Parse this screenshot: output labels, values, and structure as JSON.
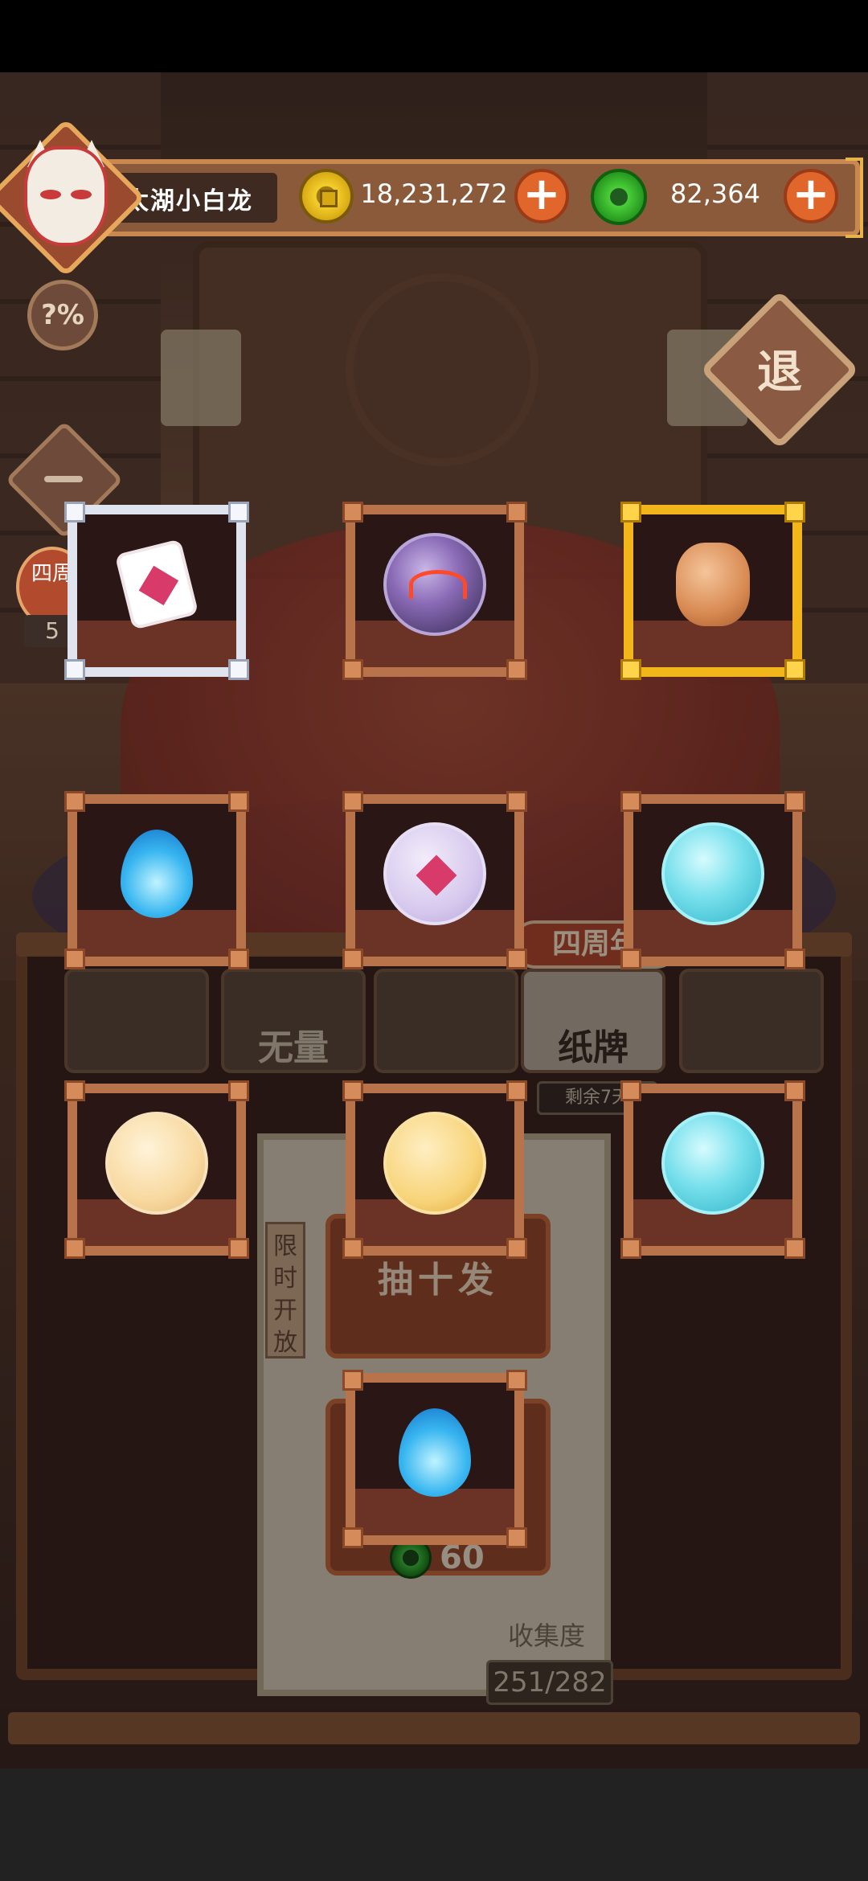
{
  "hud": {
    "player_name": "太湖小白龙",
    "coins": "18,231,272",
    "jade": "82,364",
    "add_label": "+"
  },
  "side": {
    "rate_label": "?%",
    "exit_label": "退",
    "anniversary_short": "四周",
    "anniversary_count": "5"
  },
  "shop": {
    "anniversary_banner": "四周年",
    "tabs": [
      "",
      "无量",
      "",
      "纸牌",
      ""
    ],
    "remaining": "剩余7天",
    "limited_label": "限时开放",
    "draw_ten_label": "抽十发",
    "single_price": "60",
    "collection_label": "收集度",
    "collection_value": "251/282"
  },
  "prizes": [
    {
      "name": "pink-card-tile",
      "rarity": "silver"
    },
    {
      "name": "purple-mask-orb",
      "rarity": "copper"
    },
    {
      "name": "copper-ox-badge",
      "rarity": "gold"
    },
    {
      "name": "blue-flame",
      "rarity": "copper"
    },
    {
      "name": "card-orb",
      "rarity": "copper"
    },
    {
      "name": "crystal-orb",
      "rarity": "copper"
    },
    {
      "name": "sword-orb",
      "rarity": "copper"
    },
    {
      "name": "helmet-orb",
      "rarity": "copper"
    },
    {
      "name": "crystal-orb",
      "rarity": "copper"
    },
    {
      "name": "blue-flame",
      "rarity": "copper"
    }
  ],
  "colors": {
    "hud_wood": "#8b5a3b",
    "add_button": "#e0662b",
    "gold_frame": "#f2b51a",
    "silver_frame": "#dfe4ef",
    "copper_frame": "#b8734a"
  }
}
